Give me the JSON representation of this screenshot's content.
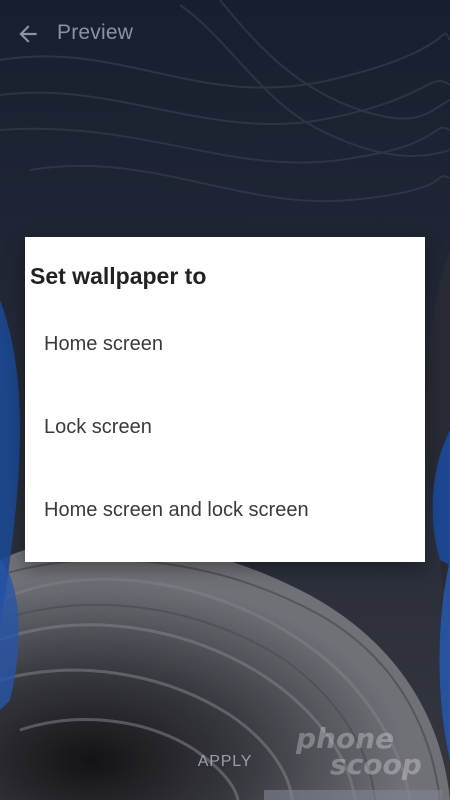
{
  "app_bar": {
    "title": "Preview",
    "back_icon": "arrow-left-icon"
  },
  "dialog": {
    "title": "Set wallpaper to",
    "options": [
      {
        "label": "Home screen"
      },
      {
        "label": "Lock screen"
      },
      {
        "label": "Home screen and lock screen"
      }
    ]
  },
  "bottom": {
    "apply_label": "APPLY"
  },
  "watermark": {
    "line1": "phone",
    "line2": "scoop"
  },
  "colors": {
    "wallpaper_dark": "#1c2230",
    "wallpaper_grey": "#6f717a",
    "wallpaper_blue": "#1f4fa0",
    "dialog_bg": "#ffffff",
    "title_text": "#222222",
    "option_text": "#3a3a3a"
  }
}
